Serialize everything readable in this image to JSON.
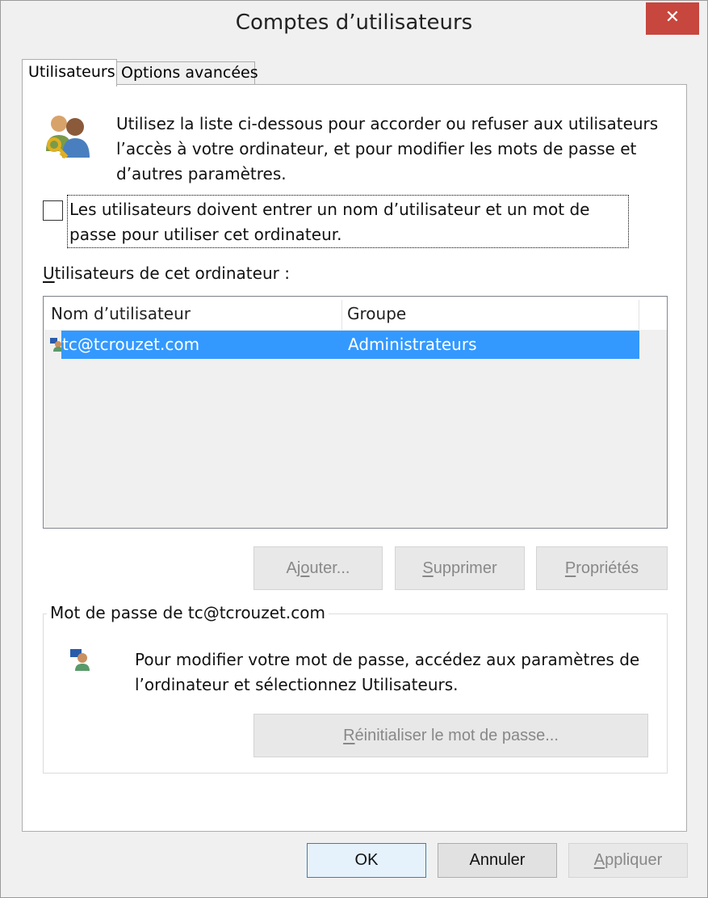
{
  "window": {
    "title": "Comptes d’utilisateurs",
    "close_glyph": "✕"
  },
  "tabs": [
    {
      "label": "Utilisateurs",
      "active": true
    },
    {
      "label": "Options avancées",
      "active": false
    }
  ],
  "intro": {
    "icon": "users-key-icon",
    "text": "Utilisez la liste ci-dessous pour accorder ou refuser aux utilisateurs l’accès à votre ordinateur, et pour modifier les mots de passe et d’autres paramètres."
  },
  "require_login": {
    "checked": false,
    "label": "Les utilisateurs doivent entrer un nom d’utilisateur et un mot de passe pour utiliser cet ordinateur."
  },
  "users_section": {
    "label_accel": "U",
    "label_rest": "tilisateurs de cet ordinateur :"
  },
  "users_table": {
    "columns": [
      "Nom d’utilisateur",
      "Groupe"
    ],
    "rows": [
      {
        "name": "tc@tcrouzet.com",
        "group": "Administrateurs",
        "selected": true,
        "icon": "user-account-icon"
      }
    ],
    "selection_color": "#3399ff"
  },
  "buttons": {
    "add": {
      "pre": "Aj",
      "accel": "o",
      "post": "uter..."
    },
    "remove": {
      "pre": "",
      "accel": "S",
      "post": "upprimer"
    },
    "properties": {
      "pre": "",
      "accel": "P",
      "post": "ropriétés"
    }
  },
  "password_group": {
    "title": "Mot de passe de tc@tcrouzet.com",
    "icon": "user-password-icon",
    "text": "Pour modifier votre mot de passe, accédez aux paramètres de l’ordinateur et sélectionnez Utilisateurs.",
    "reset": {
      "pre": "",
      "accel": "R",
      "post": "éinitialiser le mot de passe..."
    }
  },
  "footer": {
    "ok": "OK",
    "cancel": "Annuler",
    "apply": {
      "pre": "",
      "accel": "A",
      "post": "ppliquer"
    }
  },
  "colors": {
    "close_button": "#c7463e",
    "window_bg": "#f0f0f0",
    "disabled_text": "#888888"
  }
}
